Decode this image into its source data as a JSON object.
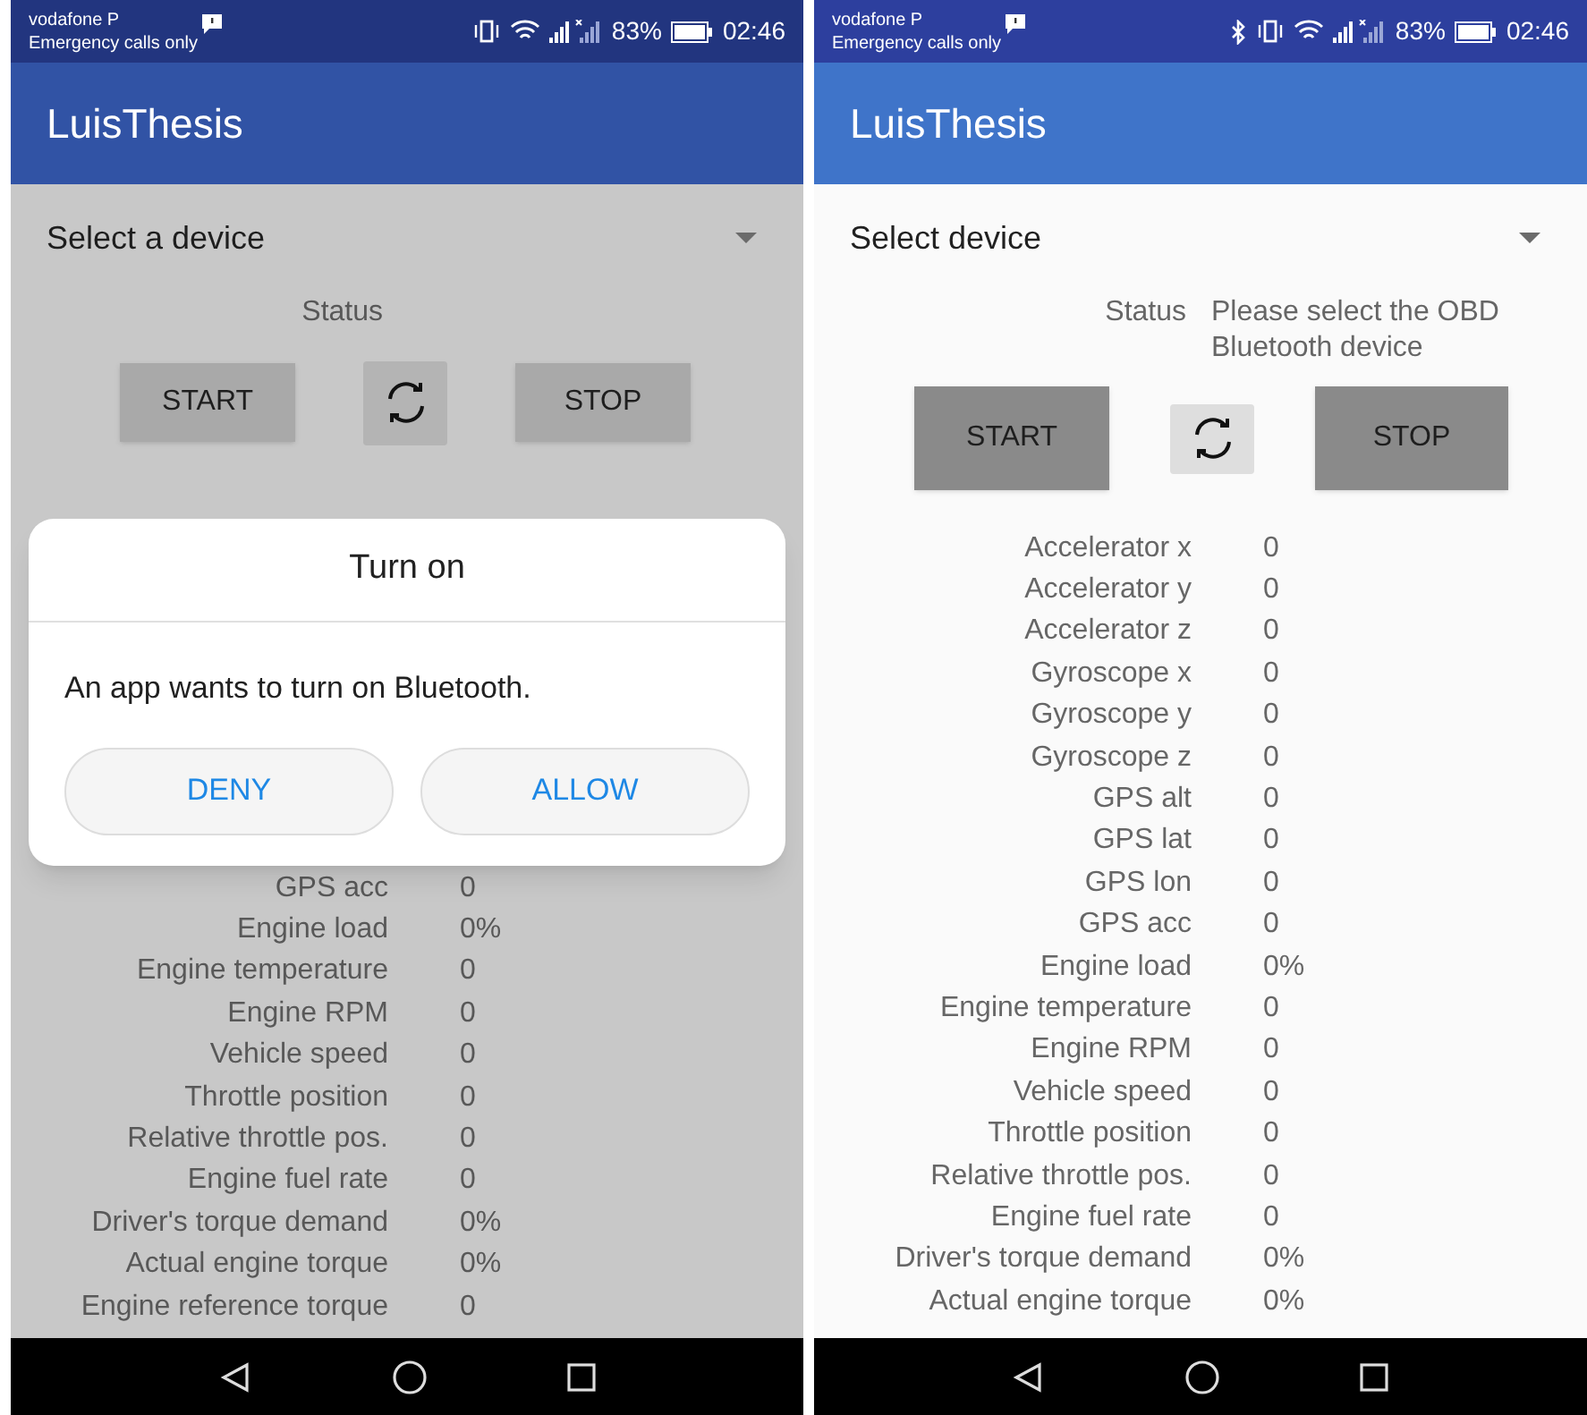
{
  "screens": [
    {
      "dimmed": true,
      "status_bar": {
        "carrier": "vodafone P",
        "note": "Emergency calls only",
        "bluetooth": false,
        "battery": "83%",
        "time": "02:46"
      },
      "app_title": "LuisThesis",
      "device_select": {
        "placeholder": "Select a device"
      },
      "status": {
        "label": "Status"
      },
      "buttons": {
        "start": "START",
        "stop": "STOP"
      },
      "readings_below_dialog": [
        {
          "label": "GPS acc",
          "value": "0"
        },
        {
          "label": "Engine load",
          "value": "0%"
        },
        {
          "label": "Engine temperature",
          "value": "0"
        },
        {
          "label": "Engine RPM",
          "value": "0"
        },
        {
          "label": "Vehicle speed",
          "value": "0"
        },
        {
          "label": "Throttle position",
          "value": "0"
        },
        {
          "label": "Relative throttle pos.",
          "value": "0"
        },
        {
          "label": "Engine fuel rate",
          "value": "0"
        },
        {
          "label": "Driver's torque demand",
          "value": "0%"
        },
        {
          "label": "Actual engine torque",
          "value": "0%"
        },
        {
          "label": "Engine reference torque",
          "value": "0"
        }
      ],
      "dialog": {
        "title": "Turn on",
        "message": "An app wants to turn on Bluetooth.",
        "buttons": [
          "DENY",
          "ALLOW"
        ]
      }
    },
    {
      "dimmed": false,
      "status_bar": {
        "carrier": "vodafone P",
        "note": "Emergency calls only",
        "bluetooth": true,
        "battery": "83%",
        "time": "02:46"
      },
      "app_title": "LuisThesis",
      "device_select": {
        "placeholder": "Select device"
      },
      "status": {
        "label": "Status",
        "text": "Please select the OBD Bluetooth device"
      },
      "buttons": {
        "start": "START",
        "stop": "STOP"
      },
      "readings": [
        {
          "label": "Accelerator x",
          "value": "0"
        },
        {
          "label": "Accelerator y",
          "value": "0"
        },
        {
          "label": "Accelerator z",
          "value": "0"
        },
        {
          "label": "Gyroscope x",
          "value": "0"
        },
        {
          "label": "Gyroscope y",
          "value": "0"
        },
        {
          "label": "Gyroscope z",
          "value": "0"
        },
        {
          "label": "GPS alt",
          "value": "0"
        },
        {
          "label": "GPS lat",
          "value": "0"
        },
        {
          "label": "GPS lon",
          "value": "0"
        },
        {
          "label": "GPS acc",
          "value": "0"
        },
        {
          "label": "Engine load",
          "value": "0%"
        },
        {
          "label": "Engine temperature",
          "value": "0"
        },
        {
          "label": "Engine RPM",
          "value": "0"
        },
        {
          "label": "Vehicle speed",
          "value": "0"
        },
        {
          "label": "Throttle position",
          "value": "0"
        },
        {
          "label": "Relative throttle pos.",
          "value": "0"
        },
        {
          "label": "Engine fuel rate",
          "value": "0"
        },
        {
          "label": "Driver's torque demand",
          "value": "0%"
        },
        {
          "label": "Actual engine torque",
          "value": "0%"
        }
      ]
    }
  ]
}
